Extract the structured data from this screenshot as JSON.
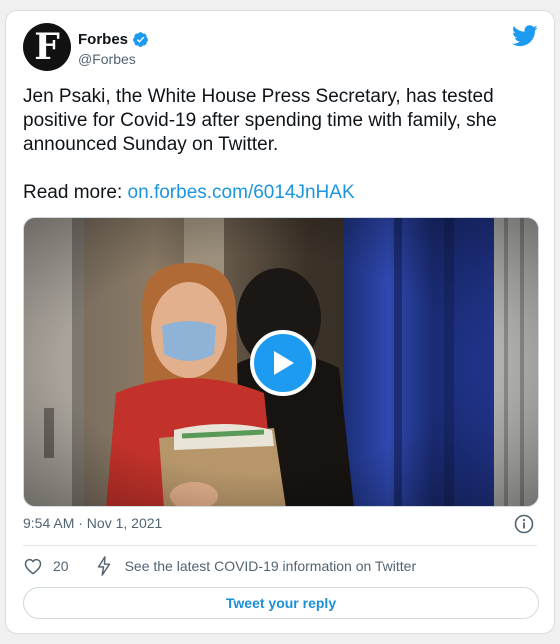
{
  "account": {
    "name": "Forbes",
    "handle": "@Forbes",
    "avatar_letter": "F"
  },
  "tweet": {
    "text_lines": [
      "Jen Psaki, the White House Press Secretary, has tested",
      "positive for Covid-19 after spending time with family, she",
      "announced Sunday on Twitter."
    ],
    "read_more_label": "Read more: ",
    "link": "on.forbes.com/6014JnHAK"
  },
  "meta": {
    "timestamp": "9:54 AM · Nov 1, 2021"
  },
  "actions": {
    "like_count": "20",
    "covid_info": "See the latest COVID-19 information on Twitter"
  },
  "reply": {
    "label": "Tweet your reply"
  },
  "colors": {
    "twitter_blue": "#1d9bf0",
    "link_blue": "#1b95e0",
    "muted": "#536471"
  },
  "icons": [
    "verified-icon",
    "twitter-bird-icon",
    "play-icon",
    "info-icon",
    "heart-icon",
    "lightning-icon"
  ]
}
